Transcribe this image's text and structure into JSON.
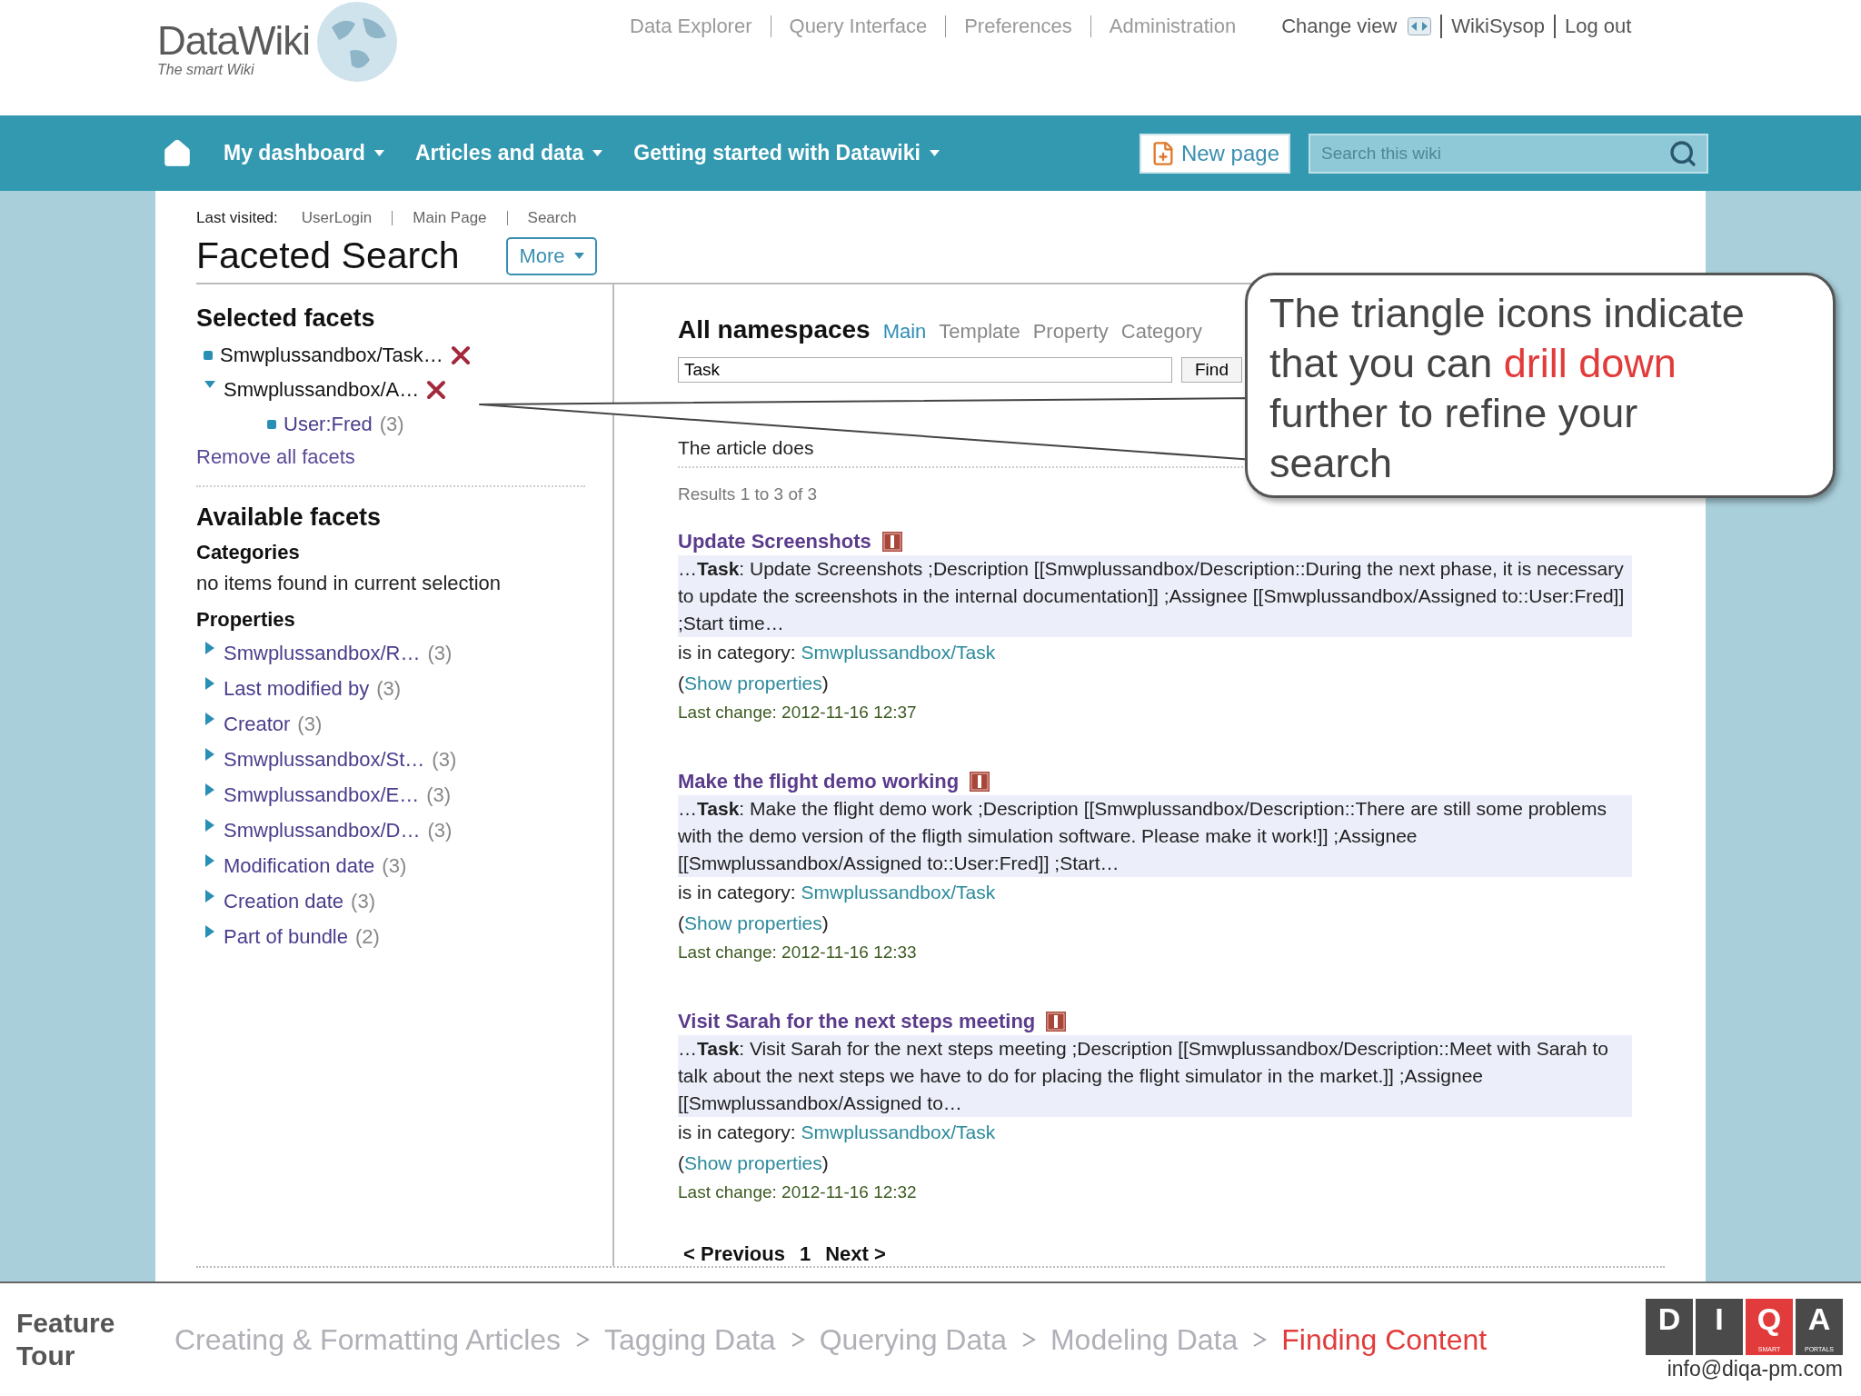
{
  "header": {
    "logo": "DataWiki",
    "tagline": "The smart Wiki",
    "top_links": [
      {
        "label": "Data Explorer"
      },
      {
        "label": "Query Interface"
      },
      {
        "label": "Preferences"
      },
      {
        "label": "Administration"
      }
    ],
    "user_links": [
      {
        "label": "Change view",
        "kind": "view-toggle"
      },
      {
        "label": "WikiSysop",
        "kind": "link"
      },
      {
        "label": "Log out",
        "kind": "link"
      }
    ]
  },
  "nav": {
    "items": [
      {
        "label": "My dashboard"
      },
      {
        "label": "Articles and data"
      },
      {
        "label": "Getting started with Datawiki"
      }
    ],
    "new_page": "New page",
    "search": {
      "placeholder": "Search this wiki"
    }
  },
  "page": {
    "last_visited_label": "Last visited:",
    "last_visited": [
      "UserLogin",
      "Main Page",
      "Search"
    ],
    "title": "Faceted Search",
    "more": "More"
  },
  "selected_facets": {
    "title": "Selected facets",
    "items": [
      {
        "label": "Smwplussandbox/Task…",
        "kind": "value",
        "removable": true
      },
      {
        "label": "Smwplussandbox/A…",
        "kind": "property",
        "expanded": true,
        "removable": true,
        "children": [
          {
            "label": "User:Fred",
            "count": "(3)",
            "kind": "value",
            "removable": false
          }
        ]
      }
    ],
    "remove_all": "Remove all facets"
  },
  "available_facets": {
    "title": "Available facets",
    "categories_title": "Categories",
    "categories_empty": "no items found in current selection",
    "properties_title": "Properties",
    "properties": [
      {
        "label": "Smwplussandbox/R…",
        "count": "(3)",
        "expanded": false
      },
      {
        "label": "Last modified by",
        "count": "(3)",
        "expanded": false
      },
      {
        "label": "Creator",
        "count": "(3)",
        "expanded": false
      },
      {
        "label": "Smwplussandbox/St…",
        "count": "(3)",
        "expanded": false
      },
      {
        "label": "Smwplussandbox/E…",
        "count": "(3)",
        "expanded": false
      },
      {
        "label": "Smwplussandbox/D…",
        "count": "(3)",
        "expanded": false
      },
      {
        "label": "Modification date",
        "count": "(3)",
        "expanded": false
      },
      {
        "label": "Creation date",
        "count": "(3)",
        "expanded": false
      },
      {
        "label": "Part of bundle",
        "count": "(2)",
        "expanded": false
      }
    ]
  },
  "search": {
    "heading": "All namespaces",
    "namespaces": [
      {
        "label": "Main",
        "selected": true
      },
      {
        "label": "Template",
        "selected": false
      },
      {
        "label": "Property",
        "selected": false
      },
      {
        "label": "Category",
        "selected": false
      }
    ],
    "query": "Task",
    "find": "Find",
    "notice": "The article does",
    "results_count": "Results 1 to 3 of 3",
    "results": [
      {
        "title": "Update Screenshots",
        "snippet": "…**Task**: Update Screenshots ;Description [[Smwplussandbox/Description::During the next phase, it is necessary to update the screenshots in the internal documentation]] ;Assignee [[Smwplussandbox/Assigned to::User:Fred]] ;Start time…",
        "category_label": "is in category:",
        "category": "Smwplussandbox/Task",
        "properties": {
          "before": "(",
          "link": "Show properties",
          "after": ")"
        },
        "last_change": "Last change: 2012-11-16 12:37"
      },
      {
        "title": "Make the flight demo working",
        "snippet": "…**Task**: Make the flight demo work ;Description [[Smwplussandbox/Description::There are still some problems with the demo version of the fligth simulation software. Please make it work!]] ;Assignee [[Smwplussandbox/Assigned to::User:Fred]] ;Start…",
        "category_label": "is in category:",
        "category": "Smwplussandbox/Task",
        "properties": {
          "before": "(",
          "link": "Show properties",
          "after": ")"
        },
        "last_change": "Last change: 2012-11-16 12:33"
      },
      {
        "title": "Visit Sarah for the next steps meeting",
        "snippet": "…**Task**: Visit Sarah for the next steps meeting ;Description [[Smwplussandbox/Description::Meet with Sarah to talk about the next steps we have to do for placing the flight simulator in the market.]] ;Assignee [[Smwplussandbox/Assigned to…",
        "category_label": "is in category:",
        "category": "Smwplussandbox/Task",
        "properties": {
          "before": "(",
          "link": "Show properties",
          "after": ")"
        },
        "last_change": "Last change: 2012-11-16 12:32"
      }
    ],
    "pagination": {
      "previous": "< Previous",
      "page": "1",
      "next": "Next >"
    }
  },
  "callout": {
    "before": "The triangle icons indicate that you can",
    "highlight": "drill down",
    "after": "further to refine your search"
  },
  "footer": {
    "title": "Feature Tour",
    "steps": [
      {
        "label": "Creating & Formatting Articles",
        "selected": false
      },
      {
        "label": "Tagging Data",
        "selected": false
      },
      {
        "label": "Querying Data",
        "selected": false
      },
      {
        "label": "Modeling Data",
        "selected": false
      },
      {
        "label": "Finding Content",
        "selected": true
      }
    ],
    "logo": [
      {
        "letter": "D",
        "color": "#4a4a4a"
      },
      {
        "letter": "I",
        "color": "#4a4a4a"
      },
      {
        "letter": "Q",
        "color": "#e23b3b",
        "caption": "SMART"
      },
      {
        "letter": "A",
        "color": "#4a4a4a",
        "caption": "PORTALS"
      }
    ],
    "email": "info@diqa-pm.com"
  }
}
